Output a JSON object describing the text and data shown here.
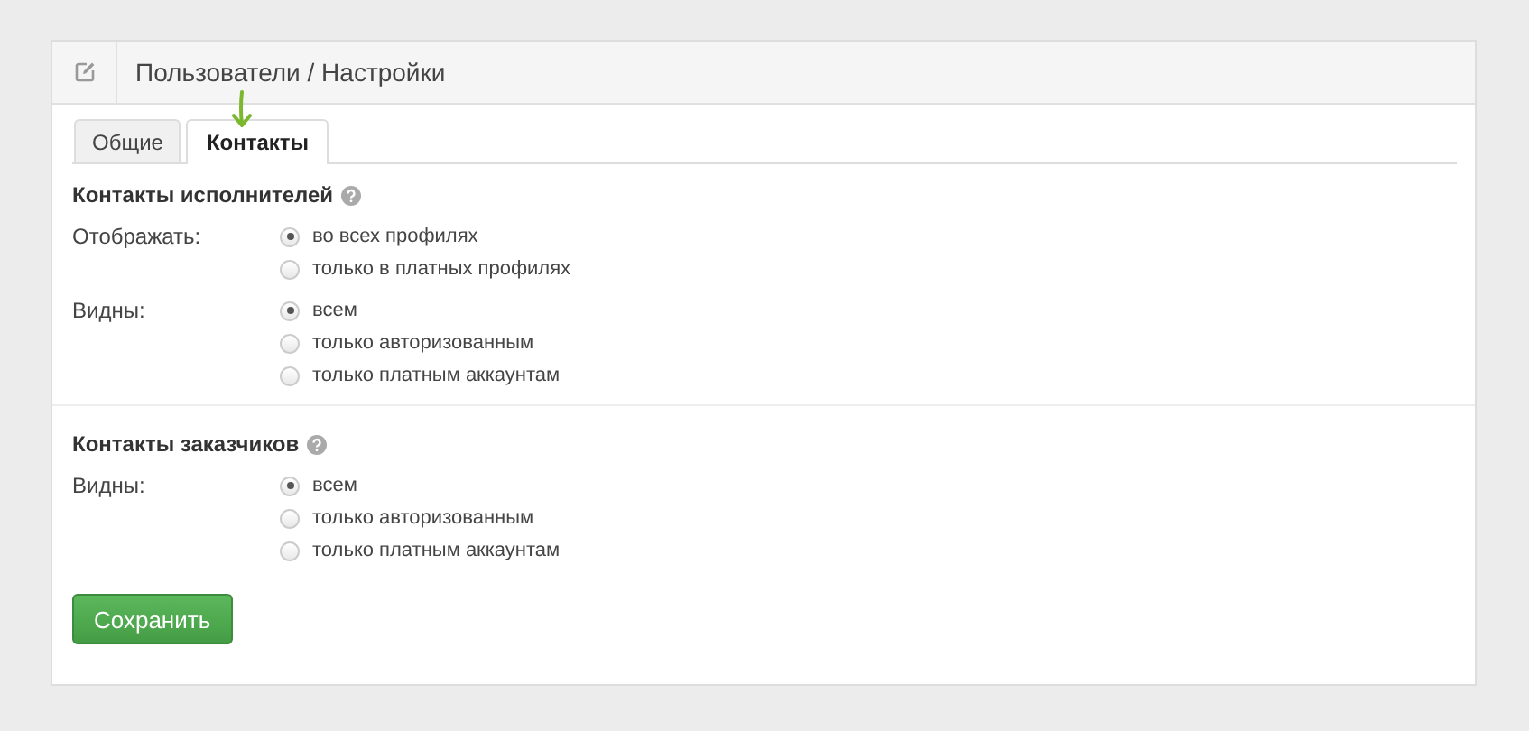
{
  "header": {
    "title": "Пользователи / Настройки"
  },
  "tabs": [
    {
      "label": "Общие",
      "selected": false
    },
    {
      "label": "Контакты",
      "selected": true
    }
  ],
  "sections": [
    {
      "title": "Контакты исполнителей",
      "groups": [
        {
          "label": "Отображать:",
          "options": [
            {
              "label": "во всех профилях",
              "selected": true
            },
            {
              "label": "только в платных профилях",
              "selected": false
            }
          ]
        },
        {
          "label": "Видны:",
          "options": [
            {
              "label": "всем",
              "selected": true
            },
            {
              "label": "только авторизованным",
              "selected": false
            },
            {
              "label": "только платным аккаунтам",
              "selected": false
            }
          ]
        }
      ]
    },
    {
      "title": "Контакты заказчиков",
      "groups": [
        {
          "label": "Видны:",
          "options": [
            {
              "label": "всем",
              "selected": true
            },
            {
              "label": "только авторизованным",
              "selected": false
            },
            {
              "label": "только платным аккаунтам",
              "selected": false
            }
          ]
        }
      ]
    }
  ],
  "save_button": "Сохранить"
}
